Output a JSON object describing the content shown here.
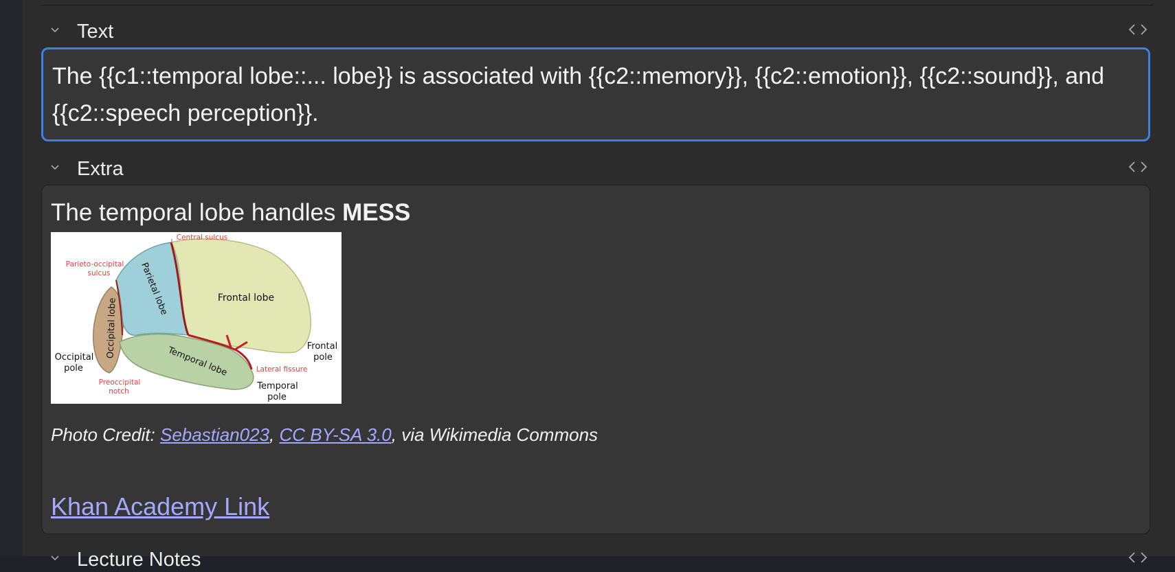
{
  "fields": {
    "text": {
      "name": "Text",
      "value": "The {{c1::temporal lobe::... lobe}} is associated with {{c2::memory}}, {{c2::emotion}}, {{c2::sound}}, and {{c2::speech perception}}."
    },
    "extra": {
      "name": "Extra",
      "heading_prefix": "The temporal lobe handles ",
      "heading_bold": "MESS",
      "image_labels": {
        "central_sulcus": "Central sulcus",
        "parieto_occipital_1": "Parieto-occipital",
        "parieto_occipital_2": "sulcus",
        "parietal_lobe": "Parietal lobe",
        "frontal_lobe": "Frontal lobe",
        "occipital_lobe": "Occipital lobe",
        "frontal_pole_1": "Frontal",
        "frontal_pole_2": "pole",
        "occipital_pole_1": "Occipital",
        "occipital_pole_2": "pole",
        "temporal_lobe": "Temporal lobe",
        "lateral_fissure": "Lateral fissure",
        "preoccipital_1": "Preoccipital",
        "preoccipital_2": "notch",
        "temporal_pole_1": "Temporal",
        "temporal_pole_2": "pole"
      },
      "credit_prefix": "Photo Credit: ",
      "credit_author": "Sebastian023",
      "credit_sep": ", ",
      "credit_license": "CC BY-SA 3.0",
      "credit_suffix": ", via Wikimedia Commons",
      "khan_link": "Khan Academy Link"
    },
    "lecture_notes": {
      "name": "Lecture Notes"
    }
  },
  "colors": {
    "focus_border": "#3b82e6",
    "link": "#a4a8ff",
    "panel_bg": "#2c2c2c",
    "editor_bg": "#363636"
  },
  "icons": {
    "collapse": "chevron-down-icon",
    "html_toggle": "code-toggle-icon"
  }
}
